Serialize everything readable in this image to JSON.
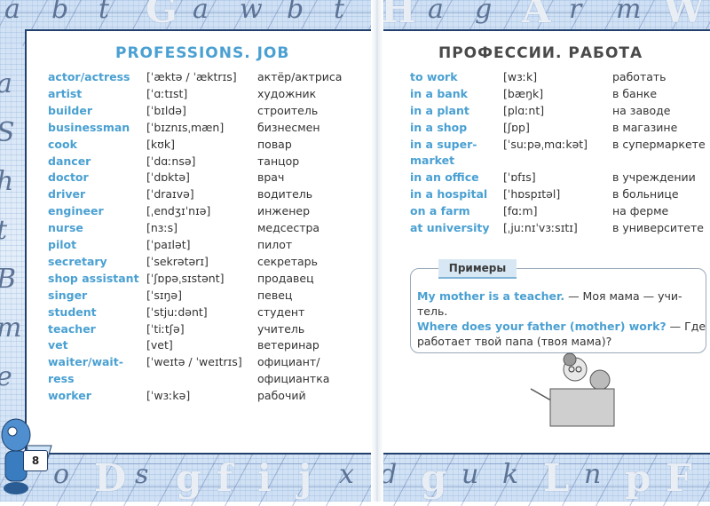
{
  "left_page": {
    "title": "PROFESSIONS. JOB",
    "page_number": "8",
    "entries": [
      {
        "en": "actor/actress",
        "transcription": "[ˈæktə / ˈæktrɪs]",
        "ru": "актёр/актриса"
      },
      {
        "en": "artist",
        "transcription": "[ˈɑːtɪst]",
        "ru": "художник"
      },
      {
        "en": "builder",
        "transcription": "[ˈbɪldə]",
        "ru": "строитель"
      },
      {
        "en": "businessman",
        "transcription": "[ˈbɪznɪsˌmæn]",
        "ru": "бизнесмен"
      },
      {
        "en": "cook",
        "transcription": "[kʊk]",
        "ru": "повар"
      },
      {
        "en": "dancer",
        "transcription": "[ˈdɑːnsə]",
        "ru": "танцор"
      },
      {
        "en": "doctor",
        "transcription": "[ˈdɒktə]",
        "ru": "врач"
      },
      {
        "en": "driver",
        "transcription": "[ˈdraɪvə]",
        "ru": "водитель"
      },
      {
        "en": "engineer",
        "transcription": "[ˌendʒɪˈnɪə]",
        "ru": "инженер"
      },
      {
        "en": "nurse",
        "transcription": "[nɜːs]",
        "ru": "медсестра"
      },
      {
        "en": "pilot",
        "transcription": "[ˈpaɪlət]",
        "ru": "пилот"
      },
      {
        "en": "secretary",
        "transcription": "[ˈsekrətərɪ]",
        "ru": "секретарь"
      },
      {
        "en": "shop assistant",
        "transcription": "[ˈʃɒpəˌsɪstənt]",
        "ru": "продавец"
      },
      {
        "en": "singer",
        "transcription": "[ˈsɪŋə]",
        "ru": "певец"
      },
      {
        "en": "student",
        "transcription": "[ˈstjuːdənt]",
        "ru": "студент"
      },
      {
        "en": "teacher",
        "transcription": "[ˈtiːtʃə]",
        "ru": "учитель"
      },
      {
        "en": "vet",
        "transcription": "[vet]",
        "ru": "ветеринар"
      },
      {
        "en": "waiter/wait-",
        "en2": "ress",
        "transcription": "[ˈweɪtə / ˈweɪtrɪs]",
        "ru": "официант/",
        "ru2": "официантка"
      },
      {
        "en": "worker",
        "transcription": "[ˈwɜːkə]",
        "ru": "рабочий"
      }
    ]
  },
  "right_page": {
    "title": "ПРОФЕССИИ. РАБОТА",
    "entries": [
      {
        "en": "to work",
        "transcription": "[wɜːk]",
        "ru": "работать"
      },
      {
        "en": "in a bank",
        "transcription": "[bæŋk]",
        "ru": "в банке"
      },
      {
        "en": "in a plant",
        "transcription": "[plɑːnt]",
        "ru": "на заводе"
      },
      {
        "en": "in a shop",
        "transcription": "[ʃɒp]",
        "ru": "в магазине"
      },
      {
        "en": "in a super-",
        "en2": "market",
        "transcription": "[ˈsuːpəˌmɑːkət]",
        "ru": "в супермаркете"
      },
      {
        "en": "in an office",
        "transcription": "[ˈɒfɪs]",
        "ru": "в учреждении"
      },
      {
        "en": "in a hospital",
        "transcription": "[ˈhɒspɪtəl]",
        "ru": "в больнице"
      },
      {
        "en": "on a farm",
        "transcription": "[fɑːm]",
        "ru": "на ферме"
      },
      {
        "en": "at university",
        "transcription": "[ˌjuːnɪˈvɜːsɪtɪ]",
        "ru": "в университете"
      }
    ],
    "examples": {
      "label": "Примеры",
      "lines": [
        {
          "en": "My mother is a teacher.",
          "ru": " — Моя мама — учи-"
        },
        {
          "en": "",
          "ru": "тель."
        },
        {
          "en": "Where does your father (mother) work?",
          "ru": " — Где"
        },
        {
          "en": "",
          "ru": "работает твой папа (твоя мама)?"
        }
      ]
    }
  },
  "decor": {
    "top_letters": [
      "a",
      "b",
      "t",
      "G",
      "a",
      "w",
      "b",
      "t",
      "H",
      "a",
      "g",
      "A",
      "r",
      "m",
      "W"
    ],
    "bottom_letters": [
      "o",
      "D",
      "s",
      "g",
      "f",
      "i",
      "j",
      "x",
      "d",
      "g",
      "u",
      "k",
      "L",
      "n",
      "p",
      "F"
    ],
    "side_letters": [
      "a",
      "S",
      "h",
      "t",
      "B",
      "m",
      "e"
    ]
  },
  "colors": {
    "english_word": "#4aa0d2",
    "russian_title": "#4a4a4a",
    "frame": "#22406e",
    "background": "#cfe0f4"
  }
}
